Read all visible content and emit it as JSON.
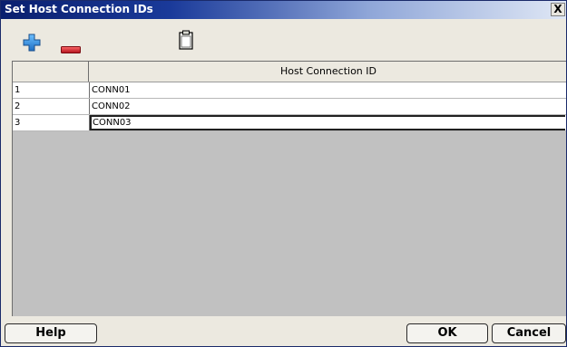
{
  "window": {
    "title": "Set Host Connection IDs",
    "close_label": "X"
  },
  "toolbar": {
    "add_icon": "plus-icon",
    "remove_icon": "minus-icon",
    "paste_icon": "clipboard-icon"
  },
  "grid": {
    "column_header": "Host Connection ID",
    "rows": [
      {
        "num": "1",
        "value": "CONN01"
      },
      {
        "num": "2",
        "value": "CONN02"
      },
      {
        "num": "3",
        "value": "CONN03"
      }
    ]
  },
  "buttons": {
    "help": "Help",
    "ok": "OK",
    "cancel": "Cancel"
  },
  "colors": {
    "title_bar": "#0a1f6e",
    "add_icon": "#2f8ad8",
    "remove_icon": "#d6232a",
    "grid_background": "#c1c1c1"
  }
}
